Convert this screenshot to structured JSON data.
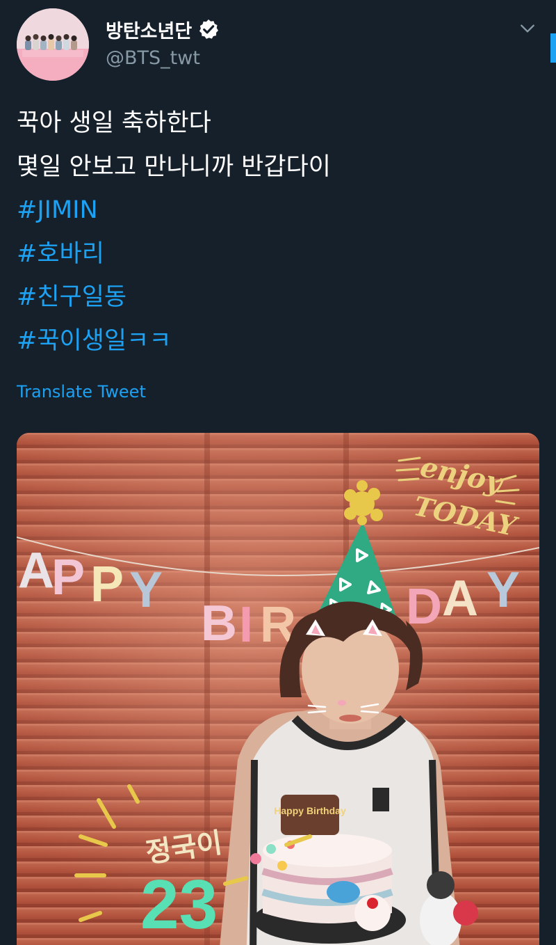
{
  "tweet": {
    "author": {
      "display_name": "방탄소년단",
      "handle": "@BTS_twt",
      "verified": true,
      "avatar_icon": "group-photo-avatar"
    },
    "lines": [
      "꾹아 생일 축하한다",
      "몇일 안보고 만나니까 반갑다이"
    ],
    "hashtags": [
      "#JIMIN",
      "#호바리",
      "#친구일동",
      "#꾹이생일ㅋㅋ"
    ],
    "translate_label": "Translate Tweet",
    "menu_icon": "chevron-down-icon"
  },
  "media": {
    "banner_letters": [
      "A",
      "P",
      "P",
      "Y",
      "B",
      "I",
      "R",
      "D",
      "A",
      "Y"
    ],
    "sticker_enjoy": "enjoy",
    "sticker_today": "TODAY",
    "sticker_name": "정국이",
    "sticker_number": "23",
    "cake_topper": "Happy Birthday"
  },
  "colors": {
    "background": "#15202b",
    "accent": "#1da1f2",
    "secondary_text": "#8899a6"
  }
}
